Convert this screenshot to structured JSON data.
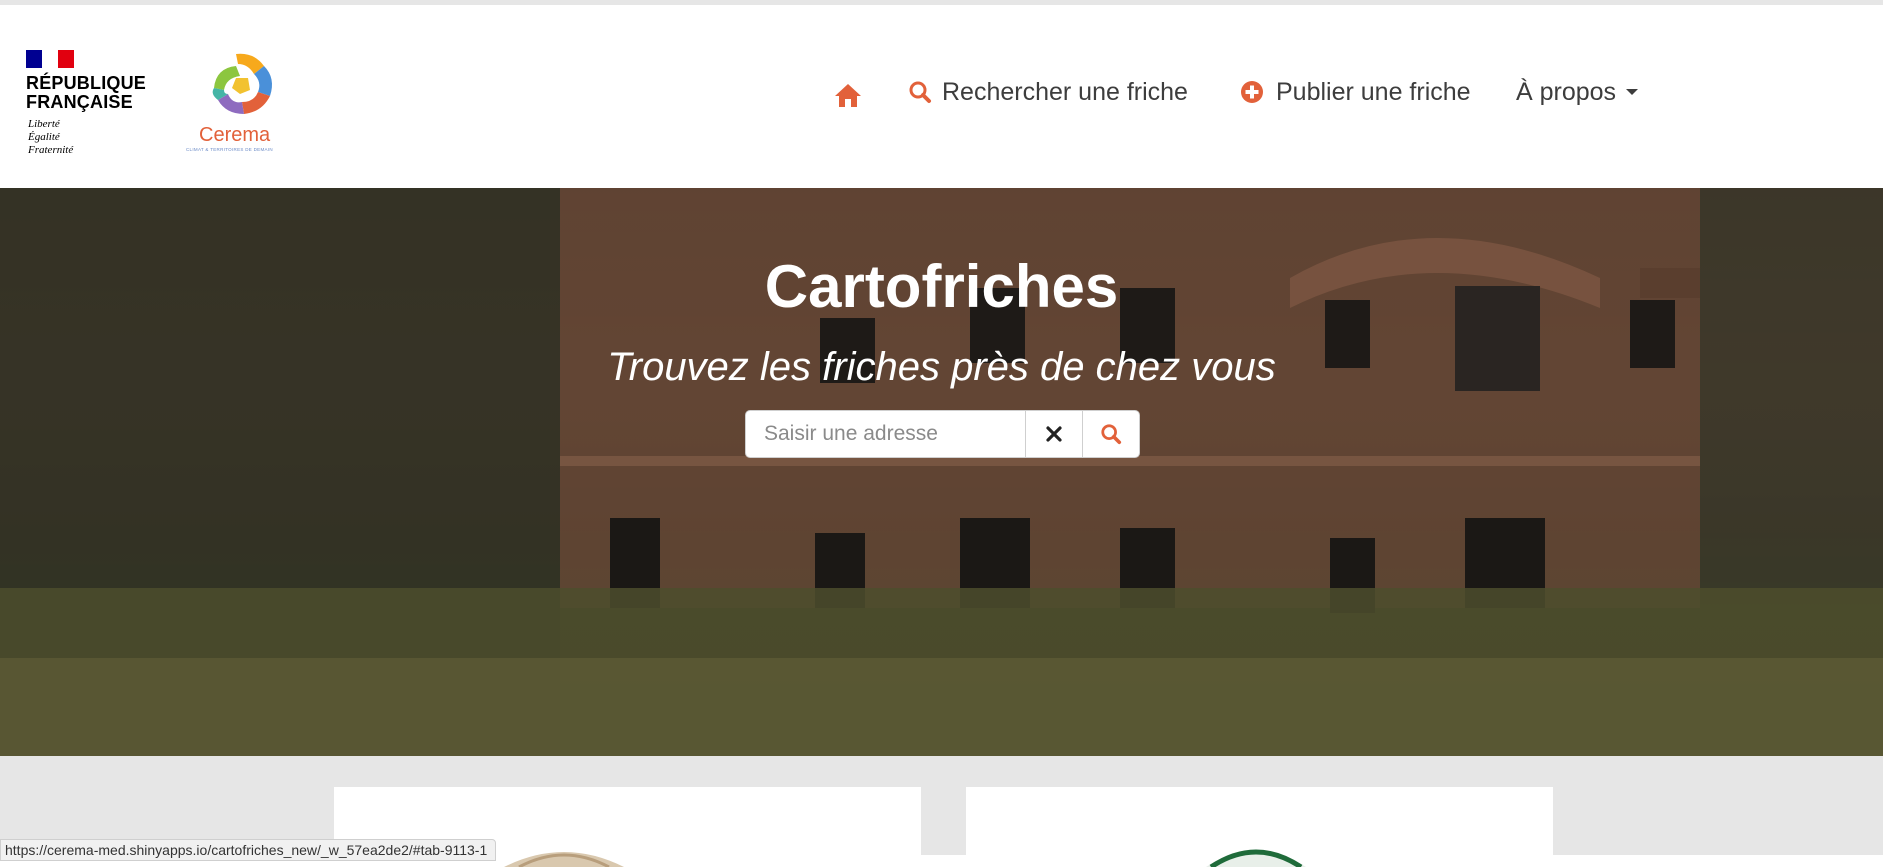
{
  "header": {
    "rf_title_line1": "RÉPUBLIQUE",
    "rf_title_line2": "FRANÇAISE",
    "rf_motto_1": "Liberté",
    "rf_motto_2": "Égalité",
    "rf_motto_3": "Fraternité",
    "cerema_name": "Cerema",
    "cerema_tagline": "CLIMAT & TERRITOIRES DE DEMAIN"
  },
  "nav": {
    "home_icon": "home-icon",
    "search_label": "Rechercher une friche",
    "publish_label": "Publier une friche",
    "about_label": "À propos"
  },
  "hero": {
    "title": "Cartofriches",
    "subtitle": "Trouvez les friches près de chez vous"
  },
  "search": {
    "placeholder": "Saisir une adresse",
    "value": ""
  },
  "colors": {
    "accent": "#e2613a",
    "nav_text": "#3d3d3d",
    "lower_bg": "#e6e6e6"
  },
  "status_bar": {
    "url": "https://cerema-med.shinyapps.io/cartofriches_new/_w_57ea2de2/#tab-9113-1"
  }
}
